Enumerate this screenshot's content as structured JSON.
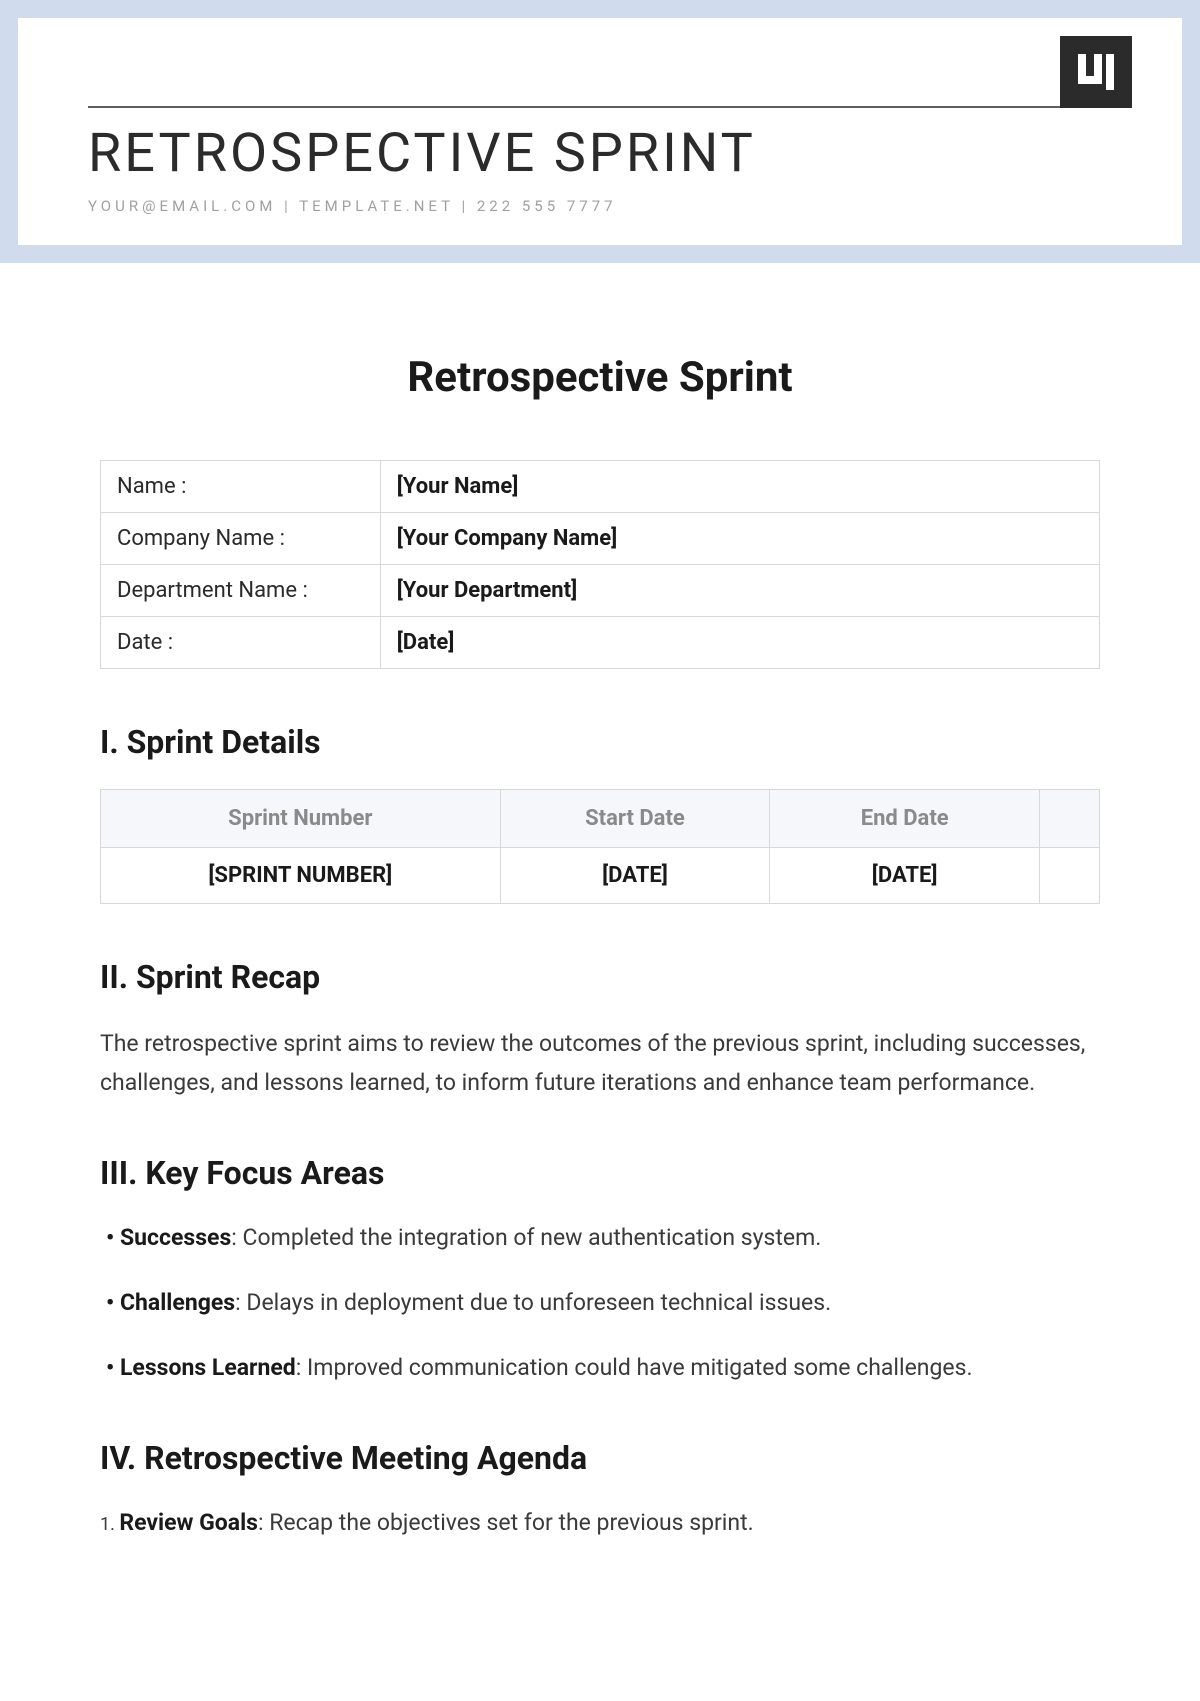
{
  "header": {
    "title": "RETROSPECTIVE SPRINT",
    "subtitle": "YOUR@EMAIL.COM | TEMPLATE.NET | 222 555 7777"
  },
  "main_title": "Retrospective Sprint",
  "info": {
    "rows": [
      {
        "label": "Name :",
        "value": "[Your Name]"
      },
      {
        "label": "Company Name :",
        "value": "[Your Company Name]"
      },
      {
        "label": "Department Name :",
        "value": "[Your Department]"
      },
      {
        "label": "Date :",
        "value": "[Date]"
      }
    ]
  },
  "sections": {
    "sprint_details": {
      "heading": "I. Sprint Details",
      "columns": [
        "Sprint Number",
        "Start Date",
        "End Date"
      ],
      "row": [
        "[SPRINT NUMBER]",
        "[DATE]",
        "[DATE]"
      ]
    },
    "sprint_recap": {
      "heading": "II. Sprint Recap",
      "text": "The retrospective sprint aims to review the outcomes of the previous sprint, including successes, challenges, and lessons learned, to inform future iterations and enhance team performance."
    },
    "key_focus": {
      "heading": "III. Key Focus Areas",
      "items": [
        {
          "label": "Successes",
          "text": ": Completed the integration of new authentication system."
        },
        {
          "label": "Challenges",
          "text": ": Delays in deployment due to unforeseen technical issues."
        },
        {
          "label": "Lessons Learned",
          "text": ": Improved communication could have mitigated some challenges."
        }
      ]
    },
    "agenda": {
      "heading": "IV. Retrospective Meeting Agenda",
      "items": [
        {
          "label": "Review Goals",
          "text": ": Recap the objectives set for the previous sprint."
        }
      ]
    }
  }
}
